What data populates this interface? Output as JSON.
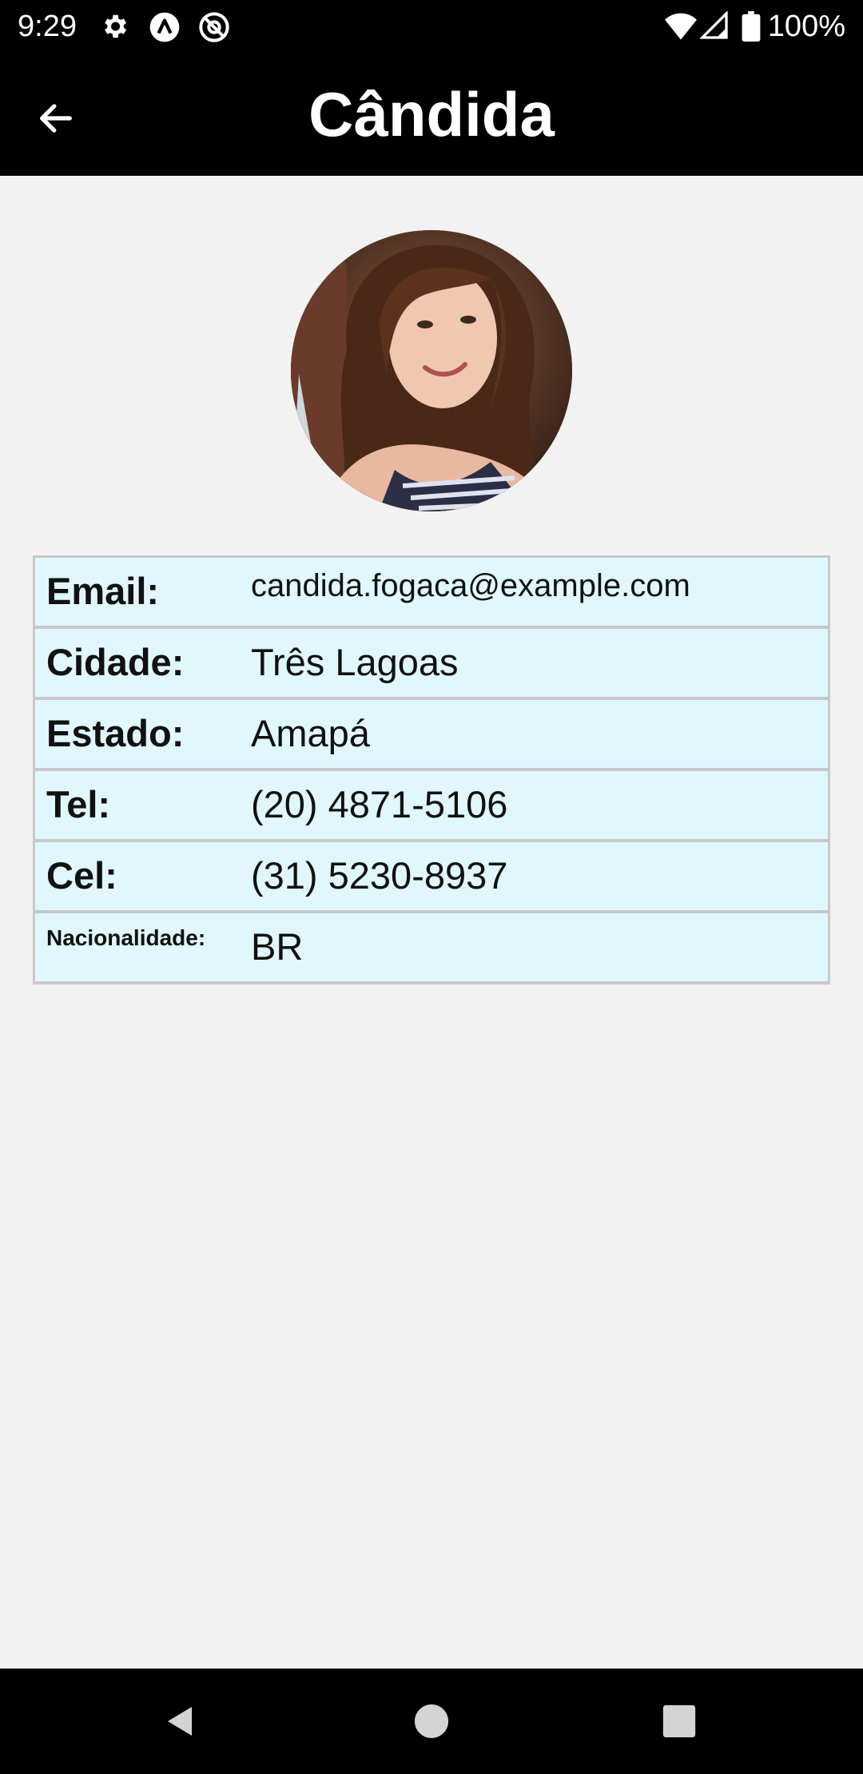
{
  "status_bar": {
    "time": "9:29",
    "battery_text": "100%",
    "icons": [
      "gear-icon",
      "app-a-icon",
      "at-sign-icon",
      "wifi-icon",
      "signal-icon",
      "battery-icon"
    ]
  },
  "app_bar": {
    "title": "Cândida",
    "back_icon": "arrow-left-icon"
  },
  "profile": {
    "avatar": "profile-photo"
  },
  "details": {
    "rows": [
      {
        "label": "Email:",
        "value": "candida.fogaca@example.com"
      },
      {
        "label": "Cidade:",
        "value": "Três Lagoas"
      },
      {
        "label": "Estado:",
        "value": "Amapá"
      },
      {
        "label": "Tel:",
        "value": "(20) 4871-5106"
      },
      {
        "label": "Cel:",
        "value": "(31) 5230-8937"
      },
      {
        "label": "Nacionalidade:",
        "value": "BR"
      }
    ]
  },
  "nav_bar": {
    "buttons": [
      "back-triangle-icon",
      "home-circle-icon",
      "recents-square-icon"
    ]
  },
  "colors": {
    "bar_background": "#000000",
    "page_background": "#f2f2f2",
    "row_background": "#e0f7fd",
    "row_border": "#c8c8c8"
  }
}
